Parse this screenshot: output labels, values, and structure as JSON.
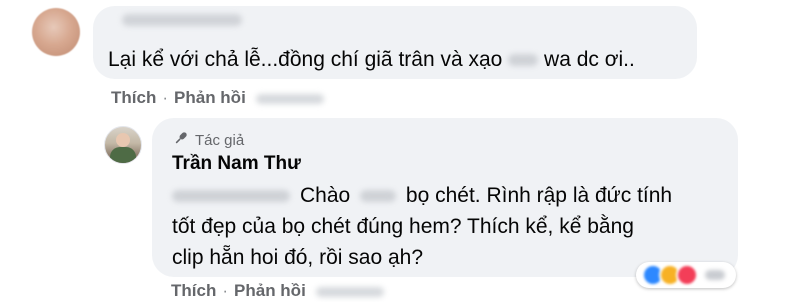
{
  "comment": {
    "text_part1": "Lại kể với chả lễ...đồng chí giã trân và xạo",
    "text_part2": "wa dc ơi..",
    "actions": {
      "like": "Thích",
      "separator": "·",
      "reply": "Phản hồi"
    }
  },
  "reply": {
    "badge": "Tác giả",
    "author": "Trần Nam Thư",
    "line1_a": "Chào",
    "line1_b": "bọ chét. Rình rập là đức tính",
    "line2": "tốt đẹp của bọ chét đúng hem? Thích kể, kể bằng",
    "line3": "clip hẵn hoi đó, rồi sao ạh?",
    "actions": {
      "like": "Thích",
      "separator": "·",
      "reply": "Phản hồi"
    },
    "reactions": [
      {
        "name": "like",
        "color": "#2d88ff"
      },
      {
        "name": "haha",
        "color": "#f7b125"
      },
      {
        "name": "love",
        "color": "#f33e58"
      }
    ]
  },
  "icons": {
    "author_badge": "microphone-icon"
  }
}
